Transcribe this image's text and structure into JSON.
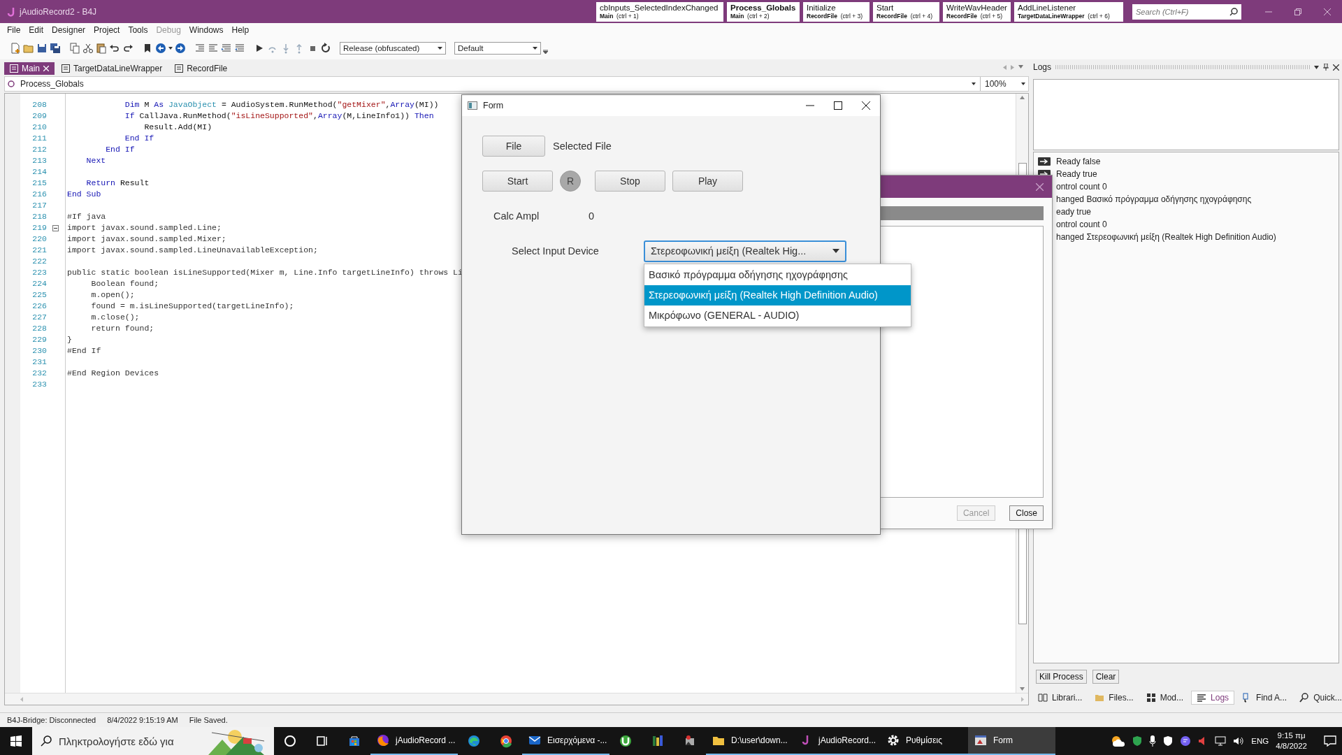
{
  "window": {
    "title": "jAudioRecord2 - B4J"
  },
  "title_tabs": [
    {
      "title": "cbInputs_SelectedIndexChanged",
      "module": "Main",
      "shortcut": "(ctrl + 1)",
      "selected": false
    },
    {
      "title": "Process_Globals",
      "module": "Main",
      "shortcut": "(ctrl + 2)",
      "selected": true
    },
    {
      "title": "Initialize",
      "module": "RecordFile",
      "shortcut": "(ctrl + 3)",
      "selected": false
    },
    {
      "title": "Start",
      "module": "RecordFile",
      "shortcut": "(ctrl + 4)",
      "selected": false
    },
    {
      "title": "WriteWavHeader",
      "module": "RecordFile",
      "shortcut": "(ctrl + 5)",
      "selected": false
    },
    {
      "title": "AddLineListener",
      "module": "TargetDataLineWrapper",
      "shortcut": "(ctrl + 6)",
      "selected": false
    }
  ],
  "search": {
    "placeholder": "Search (Ctrl+F)"
  },
  "menu": [
    {
      "label": "File",
      "disabled": false
    },
    {
      "label": "Edit",
      "disabled": false
    },
    {
      "label": "Designer",
      "disabled": false
    },
    {
      "label": "Project",
      "disabled": false
    },
    {
      "label": "Tools",
      "disabled": false
    },
    {
      "label": "Debug",
      "disabled": true
    },
    {
      "label": "Windows",
      "disabled": false
    },
    {
      "label": "Help",
      "disabled": false
    }
  ],
  "toolbar": {
    "build_config": "Release (obfuscated)",
    "symbols": "Default"
  },
  "editor_tabs": [
    {
      "label": "Main",
      "selected": true
    },
    {
      "label": "TargetDataLineWrapper",
      "selected": false
    },
    {
      "label": "RecordFile",
      "selected": false
    }
  ],
  "sub_selector": "Process_Globals",
  "zoom": "100%",
  "code_lines": [
    {
      "number": "208",
      "segments": [
        {
          "kind": "kw",
          "t": "            Dim"
        },
        {
          "kind": "plain",
          "t": " M "
        },
        {
          "kind": "kw",
          "t": "As"
        },
        {
          "kind": "type",
          "t": " JavaObject"
        },
        {
          "kind": "plain",
          "t": " = AudioSystem.RunMethod("
        },
        {
          "kind": "str",
          "t": "\"getMixer\""
        },
        {
          "kind": "plain",
          "t": ","
        },
        {
          "kind": "kw",
          "t": "Array"
        },
        {
          "kind": "plain",
          "t": "(MI))"
        }
      ]
    },
    {
      "number": "209",
      "segments": [
        {
          "kind": "kw",
          "t": "            If"
        },
        {
          "kind": "plain",
          "t": " CallJava.RunMethod("
        },
        {
          "kind": "str",
          "t": "\"isLineSupported\""
        },
        {
          "kind": "plain",
          "t": ","
        },
        {
          "kind": "kw",
          "t": "Array"
        },
        {
          "kind": "plain",
          "t": "(M,LineInfo1)) "
        },
        {
          "kind": "kw",
          "t": "Then"
        }
      ]
    },
    {
      "number": "210",
      "segments": [
        {
          "kind": "plain",
          "t": "                Result.Add(MI)"
        }
      ]
    },
    {
      "number": "211",
      "segments": [
        {
          "kind": "kw",
          "t": "            End If"
        }
      ]
    },
    {
      "number": "212",
      "segments": [
        {
          "kind": "kw",
          "t": "        End If"
        }
      ]
    },
    {
      "number": "213",
      "segments": [
        {
          "kind": "kw",
          "t": "    Next"
        }
      ]
    },
    {
      "number": "214"
    },
    {
      "number": "215",
      "segments": [
        {
          "kind": "kw",
          "t": "    Return"
        },
        {
          "kind": "plain",
          "t": " Result"
        }
      ]
    },
    {
      "number": "216",
      "segments": [
        {
          "kind": "kw",
          "t": "End Sub"
        }
      ]
    },
    {
      "number": "217"
    },
    {
      "number": "218",
      "segments": [
        {
          "kind": "java",
          "t": "#If java"
        }
      ]
    },
    {
      "number": "219",
      "expanded": true,
      "segments": [
        {
          "kind": "java",
          "t": "import javax.sound.sampled.Line;"
        }
      ]
    },
    {
      "number": "220",
      "segments": [
        {
          "kind": "java",
          "t": "import javax.sound.sampled.Mixer;"
        }
      ]
    },
    {
      "number": "221",
      "segments": [
        {
          "kind": "java",
          "t": "import javax.sound.sampled.LineUnavailableException;"
        }
      ]
    },
    {
      "number": "222"
    },
    {
      "number": "223",
      "segments": [
        {
          "kind": "java",
          "t": "public static boolean isLineSupported(Mixer m, Line.Info targetLineInfo) throws Li"
        }
      ]
    },
    {
      "number": "224",
      "segments": [
        {
          "kind": "java",
          "t": "     Boolean found;"
        }
      ]
    },
    {
      "number": "225",
      "segments": [
        {
          "kind": "java",
          "t": "     m.open();"
        }
      ]
    },
    {
      "number": "226",
      "segments": [
        {
          "kind": "java",
          "t": "     found = m.isLineSupported(targetLineInfo);"
        }
      ]
    },
    {
      "number": "227",
      "segments": [
        {
          "kind": "java",
          "t": "     m.close();"
        }
      ]
    },
    {
      "number": "228",
      "segments": [
        {
          "kind": "java",
          "t": "     return found;"
        }
      ]
    },
    {
      "number": "229",
      "segments": [
        {
          "kind": "java",
          "t": "}"
        }
      ]
    },
    {
      "number": "230",
      "segments": [
        {
          "kind": "java",
          "t": "#End If"
        }
      ]
    },
    {
      "number": "231"
    },
    {
      "number": "232",
      "segments": [
        {
          "kind": "java",
          "t": "#End Region Devices"
        }
      ]
    },
    {
      "number": "233"
    }
  ],
  "form": {
    "title": "Form",
    "file_button": "File",
    "selected_file": "Selected File",
    "controls": [
      {
        "kind": "button",
        "label": "Start"
      },
      {
        "kind": "round",
        "label": "R"
      },
      {
        "kind": "button",
        "label": "Stop"
      },
      {
        "kind": "button",
        "label": "Play"
      }
    ],
    "calc_label": "Calc Ampl",
    "calc_value": "0",
    "device_label": "Select Input Device",
    "combo_value": "Στερεοφωνική μείξη (Realtek Hig...",
    "options": [
      {
        "label": "Βασικό πρόγραμμα οδήγησης ηχογράφησης",
        "selected": false
      },
      {
        "label": "Στερεοφωνική μείξη (Realtek High Definition Audio)",
        "selected": true
      },
      {
        "label": "Μικρόφωνο (GENERAL - AUDIO)",
        "selected": false
      }
    ]
  },
  "dialog": {
    "buttons": [
      {
        "label": "Cancel",
        "disabled": true
      },
      {
        "label": "Close",
        "disabled": false
      }
    ]
  },
  "logs": {
    "title": "Logs",
    "entries": [
      {
        "text": "Ready false",
        "icon": true
      },
      {
        "text": "Ready true",
        "icon": true
      },
      {
        "text": "ontrol count 0",
        "icon": false
      },
      {
        "text": "hanged Βασικό πρόγραμμα οδήγησης ηχογράφησης",
        "icon": false
      },
      {
        "text": "eady true",
        "icon": false
      },
      {
        "text": "ontrol count 0",
        "icon": false
      },
      {
        "text": "hanged Στερεοφωνική μείξη (Realtek High Definition Audio)",
        "icon": false
      }
    ],
    "buttons": [
      "Kill Process",
      "Clear"
    ],
    "panel_tabs": [
      {
        "label": "Librari...",
        "selected": false
      },
      {
        "label": "Files...",
        "selected": false
      },
      {
        "label": "Mod...",
        "selected": false
      },
      {
        "label": "Logs",
        "selected": true
      },
      {
        "label": "Find A...",
        "selected": false
      },
      {
        "label": "Quick...",
        "selected": false
      }
    ]
  },
  "status_bar": [
    "B4J-Bridge: Disconnected",
    "8/4/2022 9:15:19 AM",
    "File Saved."
  ],
  "taskbar": {
    "search_placeholder": "Πληκτρολογήστε εδώ για",
    "items": [
      {
        "kind": "icon"
      },
      {
        "kind": "icon"
      },
      {
        "kind": "icon"
      },
      {
        "kind": "app",
        "label": "jAudioRecord ...",
        "active": false
      },
      {
        "kind": "icon"
      },
      {
        "kind": "icon"
      },
      {
        "kind": "app",
        "label": "Εισερχόμενα -...",
        "active": false
      },
      {
        "kind": "icon"
      },
      {
        "kind": "icon"
      },
      {
        "kind": "icon"
      },
      {
        "kind": "app",
        "label": "D:\\user\\down...",
        "active": false
      },
      {
        "kind": "app",
        "label": "jAudioRecord...",
        "active": false
      },
      {
        "kind": "app",
        "label": "Ρυθμίσεις",
        "active": false
      },
      {
        "kind": "app",
        "label": "Form",
        "active": true
      }
    ],
    "language": "ENG",
    "time": "9:15 πμ",
    "date": "4/8/2022"
  }
}
